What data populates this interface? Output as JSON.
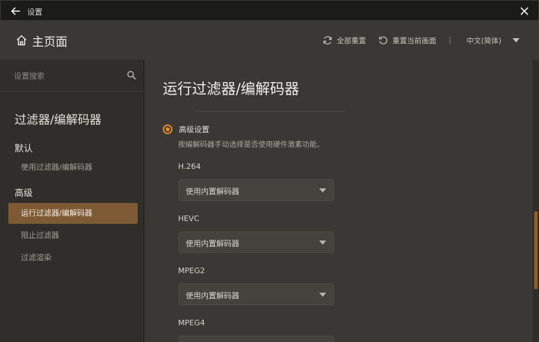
{
  "window": {
    "title": "设置"
  },
  "header": {
    "home_label": "主页面",
    "reset_all_label": "全部重置",
    "reset_current_label": "重置当前画面",
    "separator": "|",
    "language": "中文(简体)"
  },
  "sidebar": {
    "search_placeholder": "设置搜索",
    "section_title": "过滤器/编解码器",
    "groups": [
      {
        "label": "默认",
        "items": [
          {
            "label": "使用过滤器/编解码器"
          }
        ]
      },
      {
        "label": "高级",
        "items": [
          {
            "label": "运行过滤器/编解码器",
            "active": true
          },
          {
            "label": "阻止过滤器"
          },
          {
            "label": "过滤渲染"
          }
        ]
      }
    ]
  },
  "main": {
    "title": "运行过滤器/编解码器",
    "advanced_label": "高级设置",
    "advanced_selected": true,
    "advanced_desc": "按编解码器手动选择是否使用硬件激素功能。",
    "codecs": [
      {
        "label": "H.264",
        "value": "使用内置解码器"
      },
      {
        "label": "HEVC",
        "value": "使用内置解码器"
      },
      {
        "label": "MPEG2",
        "value": "使用内置解码器"
      },
      {
        "label": "MPEG4",
        "value": ""
      }
    ]
  },
  "colors": {
    "accent": "#e08a2a",
    "active_item_bg": "#7e5a34",
    "main_bg": "#3a3835",
    "sidebar_bg": "#302e2b",
    "titlebar_bg": "#1b1b1a"
  }
}
